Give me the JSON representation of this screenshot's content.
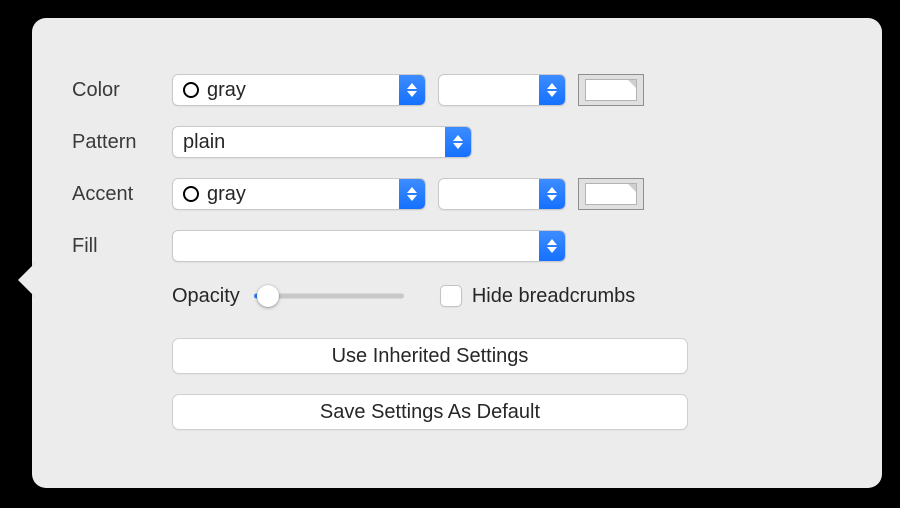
{
  "labels": {
    "color": "Color",
    "pattern": "Pattern",
    "accent": "Accent",
    "fill": "Fill",
    "opacity": "Opacity",
    "hide_breadcrumbs": "Hide breadcrumbs"
  },
  "values": {
    "color_main": "gray",
    "color_sub": "",
    "pattern": "plain",
    "accent_main": "gray",
    "accent_sub": "",
    "fill": ""
  },
  "buttons": {
    "inherit": "Use Inherited Settings",
    "save_default": "Save Settings As Default"
  },
  "state": {
    "hide_breadcrumbs_checked": false,
    "opacity_percent": 10
  },
  "colors": {
    "accent_blue": "#2a7fff"
  }
}
